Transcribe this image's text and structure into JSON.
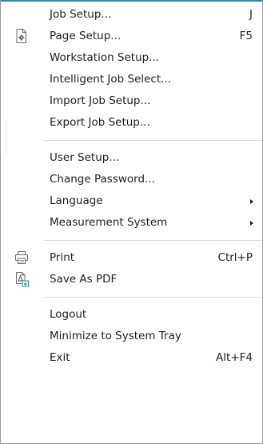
{
  "menu": {
    "groups": [
      {
        "items": [
          {
            "label": "Job Setup...",
            "shortcut": "J"
          },
          {
            "label": "Page Setup...",
            "shortcut": "F5",
            "icon": "page-setup-icon"
          },
          {
            "label": "Workstation Setup..."
          },
          {
            "label": "Intelligent Job Select..."
          },
          {
            "label": "Import Job Setup..."
          },
          {
            "label": "Export Job Setup..."
          }
        ]
      },
      {
        "items": [
          {
            "label": "User Setup..."
          },
          {
            "label": "Change Password..."
          },
          {
            "label": "Language",
            "submenu": true
          },
          {
            "label": "Measurement System",
            "submenu": true
          }
        ]
      },
      {
        "items": [
          {
            "label": "Print",
            "shortcut": "Ctrl+P",
            "icon": "printer-icon"
          },
          {
            "label": "Save As PDF",
            "icon": "pdf-save-icon"
          }
        ]
      },
      {
        "items": [
          {
            "label": "Logout"
          },
          {
            "label": "Minimize to System Tray"
          },
          {
            "label": "Exit",
            "shortcut": "Alt+F4"
          }
        ]
      }
    ],
    "accent_color": "#2a8fa0"
  }
}
